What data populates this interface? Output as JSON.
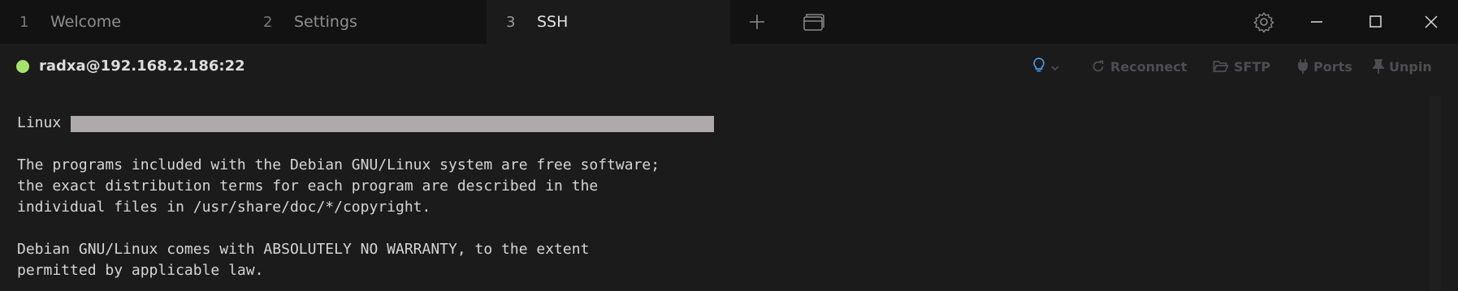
{
  "tabs": [
    {
      "number": "1",
      "title": "Welcome",
      "active": false
    },
    {
      "number": "2",
      "title": "Settings",
      "active": false
    },
    {
      "number": "3",
      "title": "SSH",
      "active": true
    }
  ],
  "header": {
    "connection": "radxa@192.168.2.186:22",
    "status_color": "#a6e36b",
    "buttons": {
      "reconnect": "Reconnect",
      "sftp": "SFTP",
      "ports": "Ports",
      "unpin": "Unpin"
    }
  },
  "terminal": {
    "lines": [
      "Linux",
      "",
      "The programs included with the Debian GNU/Linux system are free software;",
      "the exact distribution terms for each program are described in the",
      "individual files in /usr/share/doc/*/copyright.",
      "",
      "Debian GNU/Linux comes with ABSOLUTELY NO WARRANTY, to the extent",
      "permitted by applicable law."
    ]
  },
  "icons": {
    "new_tab": "plus-icon",
    "tab_overview": "tabs-icon",
    "settings": "gear-icon",
    "minimize": "minimize-icon",
    "maximize": "maximize-icon",
    "close": "close-icon",
    "hint": "lightbulb-icon"
  },
  "colors": {
    "accent": "#4a9be8",
    "status_online": "#a6e36b"
  }
}
